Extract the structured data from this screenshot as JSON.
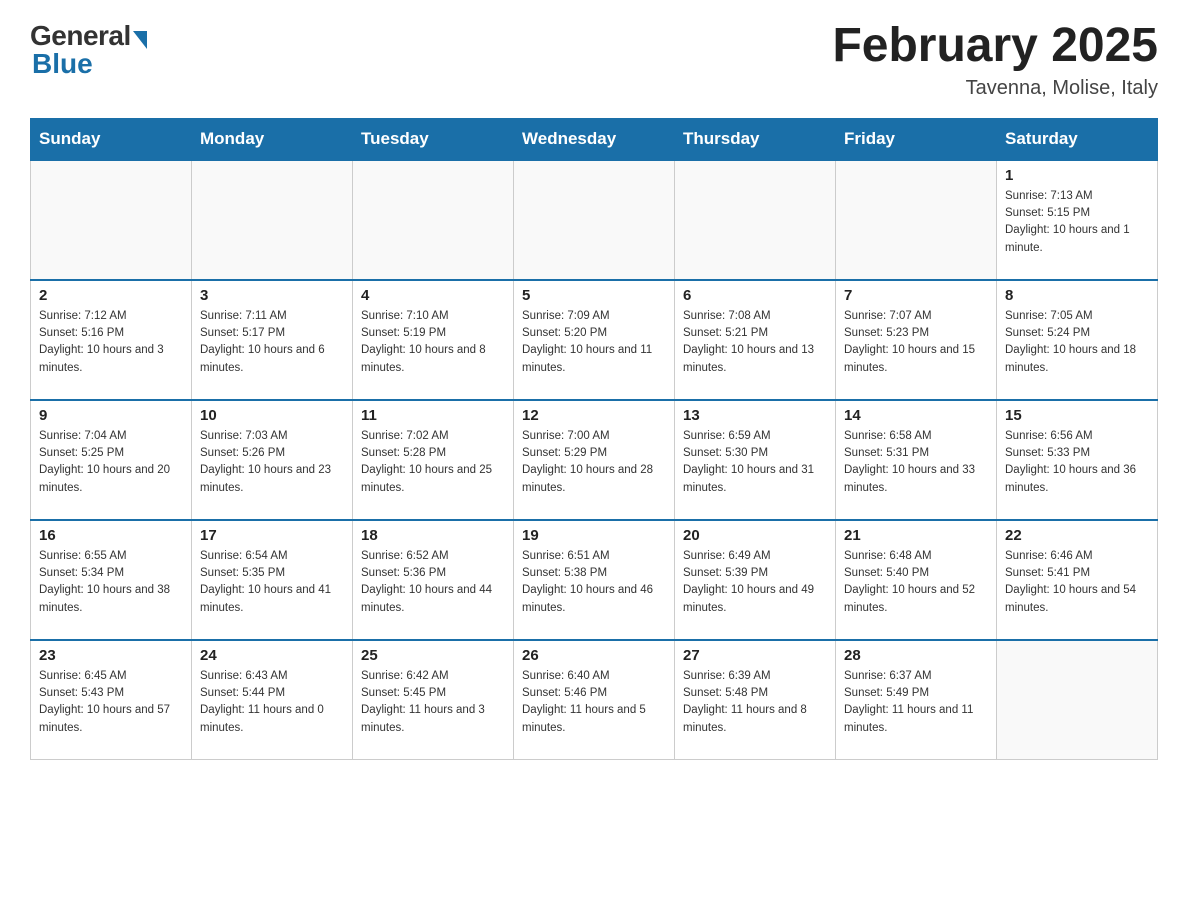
{
  "header": {
    "logo_general": "General",
    "logo_blue": "Blue",
    "month_title": "February 2025",
    "location": "Tavenna, Molise, Italy"
  },
  "days_of_week": [
    "Sunday",
    "Monday",
    "Tuesday",
    "Wednesday",
    "Thursday",
    "Friday",
    "Saturday"
  ],
  "weeks": [
    [
      {
        "day": "",
        "sunrise": "",
        "sunset": "",
        "daylight": "",
        "empty": true
      },
      {
        "day": "",
        "sunrise": "",
        "sunset": "",
        "daylight": "",
        "empty": true
      },
      {
        "day": "",
        "sunrise": "",
        "sunset": "",
        "daylight": "",
        "empty": true
      },
      {
        "day": "",
        "sunrise": "",
        "sunset": "",
        "daylight": "",
        "empty": true
      },
      {
        "day": "",
        "sunrise": "",
        "sunset": "",
        "daylight": "",
        "empty": true
      },
      {
        "day": "",
        "sunrise": "",
        "sunset": "",
        "daylight": "",
        "empty": true
      },
      {
        "day": "1",
        "sunrise": "Sunrise: 7:13 AM",
        "sunset": "Sunset: 5:15 PM",
        "daylight": "Daylight: 10 hours and 1 minute.",
        "empty": false
      }
    ],
    [
      {
        "day": "2",
        "sunrise": "Sunrise: 7:12 AM",
        "sunset": "Sunset: 5:16 PM",
        "daylight": "Daylight: 10 hours and 3 minutes.",
        "empty": false
      },
      {
        "day": "3",
        "sunrise": "Sunrise: 7:11 AM",
        "sunset": "Sunset: 5:17 PM",
        "daylight": "Daylight: 10 hours and 6 minutes.",
        "empty": false
      },
      {
        "day": "4",
        "sunrise": "Sunrise: 7:10 AM",
        "sunset": "Sunset: 5:19 PM",
        "daylight": "Daylight: 10 hours and 8 minutes.",
        "empty": false
      },
      {
        "day": "5",
        "sunrise": "Sunrise: 7:09 AM",
        "sunset": "Sunset: 5:20 PM",
        "daylight": "Daylight: 10 hours and 11 minutes.",
        "empty": false
      },
      {
        "day": "6",
        "sunrise": "Sunrise: 7:08 AM",
        "sunset": "Sunset: 5:21 PM",
        "daylight": "Daylight: 10 hours and 13 minutes.",
        "empty": false
      },
      {
        "day": "7",
        "sunrise": "Sunrise: 7:07 AM",
        "sunset": "Sunset: 5:23 PM",
        "daylight": "Daylight: 10 hours and 15 minutes.",
        "empty": false
      },
      {
        "day": "8",
        "sunrise": "Sunrise: 7:05 AM",
        "sunset": "Sunset: 5:24 PM",
        "daylight": "Daylight: 10 hours and 18 minutes.",
        "empty": false
      }
    ],
    [
      {
        "day": "9",
        "sunrise": "Sunrise: 7:04 AM",
        "sunset": "Sunset: 5:25 PM",
        "daylight": "Daylight: 10 hours and 20 minutes.",
        "empty": false
      },
      {
        "day": "10",
        "sunrise": "Sunrise: 7:03 AM",
        "sunset": "Sunset: 5:26 PM",
        "daylight": "Daylight: 10 hours and 23 minutes.",
        "empty": false
      },
      {
        "day": "11",
        "sunrise": "Sunrise: 7:02 AM",
        "sunset": "Sunset: 5:28 PM",
        "daylight": "Daylight: 10 hours and 25 minutes.",
        "empty": false
      },
      {
        "day": "12",
        "sunrise": "Sunrise: 7:00 AM",
        "sunset": "Sunset: 5:29 PM",
        "daylight": "Daylight: 10 hours and 28 minutes.",
        "empty": false
      },
      {
        "day": "13",
        "sunrise": "Sunrise: 6:59 AM",
        "sunset": "Sunset: 5:30 PM",
        "daylight": "Daylight: 10 hours and 31 minutes.",
        "empty": false
      },
      {
        "day": "14",
        "sunrise": "Sunrise: 6:58 AM",
        "sunset": "Sunset: 5:31 PM",
        "daylight": "Daylight: 10 hours and 33 minutes.",
        "empty": false
      },
      {
        "day": "15",
        "sunrise": "Sunrise: 6:56 AM",
        "sunset": "Sunset: 5:33 PM",
        "daylight": "Daylight: 10 hours and 36 minutes.",
        "empty": false
      }
    ],
    [
      {
        "day": "16",
        "sunrise": "Sunrise: 6:55 AM",
        "sunset": "Sunset: 5:34 PM",
        "daylight": "Daylight: 10 hours and 38 minutes.",
        "empty": false
      },
      {
        "day": "17",
        "sunrise": "Sunrise: 6:54 AM",
        "sunset": "Sunset: 5:35 PM",
        "daylight": "Daylight: 10 hours and 41 minutes.",
        "empty": false
      },
      {
        "day": "18",
        "sunrise": "Sunrise: 6:52 AM",
        "sunset": "Sunset: 5:36 PM",
        "daylight": "Daylight: 10 hours and 44 minutes.",
        "empty": false
      },
      {
        "day": "19",
        "sunrise": "Sunrise: 6:51 AM",
        "sunset": "Sunset: 5:38 PM",
        "daylight": "Daylight: 10 hours and 46 minutes.",
        "empty": false
      },
      {
        "day": "20",
        "sunrise": "Sunrise: 6:49 AM",
        "sunset": "Sunset: 5:39 PM",
        "daylight": "Daylight: 10 hours and 49 minutes.",
        "empty": false
      },
      {
        "day": "21",
        "sunrise": "Sunrise: 6:48 AM",
        "sunset": "Sunset: 5:40 PM",
        "daylight": "Daylight: 10 hours and 52 minutes.",
        "empty": false
      },
      {
        "day": "22",
        "sunrise": "Sunrise: 6:46 AM",
        "sunset": "Sunset: 5:41 PM",
        "daylight": "Daylight: 10 hours and 54 minutes.",
        "empty": false
      }
    ],
    [
      {
        "day": "23",
        "sunrise": "Sunrise: 6:45 AM",
        "sunset": "Sunset: 5:43 PM",
        "daylight": "Daylight: 10 hours and 57 minutes.",
        "empty": false
      },
      {
        "day": "24",
        "sunrise": "Sunrise: 6:43 AM",
        "sunset": "Sunset: 5:44 PM",
        "daylight": "Daylight: 11 hours and 0 minutes.",
        "empty": false
      },
      {
        "day": "25",
        "sunrise": "Sunrise: 6:42 AM",
        "sunset": "Sunset: 5:45 PM",
        "daylight": "Daylight: 11 hours and 3 minutes.",
        "empty": false
      },
      {
        "day": "26",
        "sunrise": "Sunrise: 6:40 AM",
        "sunset": "Sunset: 5:46 PM",
        "daylight": "Daylight: 11 hours and 5 minutes.",
        "empty": false
      },
      {
        "day": "27",
        "sunrise": "Sunrise: 6:39 AM",
        "sunset": "Sunset: 5:48 PM",
        "daylight": "Daylight: 11 hours and 8 minutes.",
        "empty": false
      },
      {
        "day": "28",
        "sunrise": "Sunrise: 6:37 AM",
        "sunset": "Sunset: 5:49 PM",
        "daylight": "Daylight: 11 hours and 11 minutes.",
        "empty": false
      },
      {
        "day": "",
        "sunrise": "",
        "sunset": "",
        "daylight": "",
        "empty": true
      }
    ]
  ]
}
